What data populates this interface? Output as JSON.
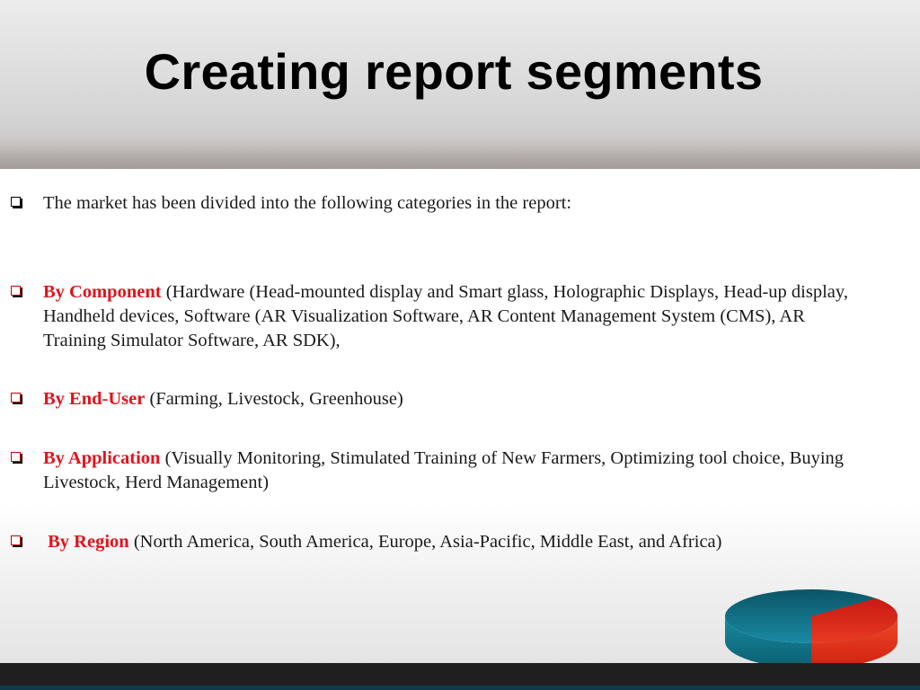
{
  "slide": {
    "title": "Creating report segments",
    "intro": "The market has been divided into the following categories in the report:",
    "segments": [
      {
        "key": "By Component",
        "detail": " (Hardware (Head-mounted display and Smart glass, Holographic Displays, Head-up display, Handheld devices, Software (AR Visualization Software, AR Content Management System (CMS), AR Training Simulator Software, AR SDK),"
      },
      {
        "key": "By End-User",
        "detail": " (Farming, Livestock, Greenhouse)"
      },
      {
        "key": "By Application",
        "detail": " (Visually Monitoring, Stimulated Training of New Farmers, Optimizing tool choice, Buying Livestock, Herd Management)"
      },
      {
        "key": " By Region",
        "detail": " (North America, South America, Europe, Asia-Pacific, Middle East, and Africa)"
      }
    ]
  },
  "colors": {
    "accent": "#e0141c",
    "title": "#000000",
    "footer": "#1f1f1f",
    "pie_teal": "#0f6f86",
    "pie_red": "#e4281c"
  },
  "icons": {
    "bullet": "square-bullet-icon",
    "decoration": "pie-chart-graphic"
  }
}
